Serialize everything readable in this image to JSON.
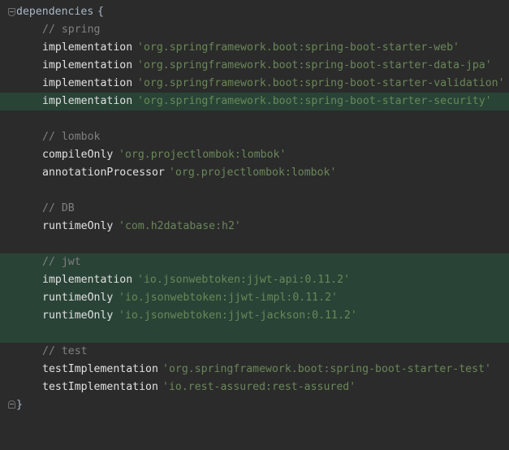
{
  "editor": {
    "header": {
      "keyword": "dependencies",
      "brace": "{"
    },
    "footer": {
      "brace": "}"
    },
    "lines": [
      {
        "type": "comment",
        "text": "// spring"
      },
      {
        "type": "dep",
        "fn": "implementation",
        "str": "'org.springframework.boot:spring-boot-starter-web'"
      },
      {
        "type": "dep",
        "fn": "implementation",
        "str": "'org.springframework.boot:spring-boot-starter-data-jpa'"
      },
      {
        "type": "dep",
        "fn": "implementation",
        "str": "'org.springframework.boot:spring-boot-starter-validation'"
      },
      {
        "type": "dep",
        "fn": "implementation",
        "str": "'org.springframework.boot:spring-boot-starter-security'",
        "highlight": true
      },
      {
        "type": "comment",
        "text": "// lombok"
      },
      {
        "type": "dep",
        "fn": "compileOnly",
        "str": "'org.projectlombok:lombok'"
      },
      {
        "type": "dep",
        "fn": "annotationProcessor",
        "str": "'org.projectlombok:lombok'"
      },
      {
        "type": "comment",
        "text": "// DB"
      },
      {
        "type": "dep",
        "fn": "runtimeOnly",
        "str": "'com.h2database:h2'"
      },
      {
        "type": "comment",
        "text": "// jwt"
      },
      {
        "type": "dep",
        "fn": "implementation",
        "str": "'io.jsonwebtoken:jjwt-api:0.11.2'"
      },
      {
        "type": "dep",
        "fn": "runtimeOnly",
        "str": "'io.jsonwebtoken:jjwt-impl:0.11.2'"
      },
      {
        "type": "dep",
        "fn": "runtimeOnly",
        "str": "'io.jsonwebtoken:jjwt-jackson:0.11.2'"
      },
      {
        "type": "comment",
        "text": "// test"
      },
      {
        "type": "dep",
        "fn": "testImplementation",
        "str": "'org.springframework.boot:spring-boot-starter-test'"
      },
      {
        "type": "dep",
        "fn": "testImplementation",
        "str": "'io.rest-assured:rest-assured'"
      }
    ],
    "colors": {
      "background": "#2b2b2b",
      "changed_line_highlight": "#294436",
      "string": "#6a8759",
      "comment": "#808080",
      "identifier": "#e0e0e0"
    }
  }
}
